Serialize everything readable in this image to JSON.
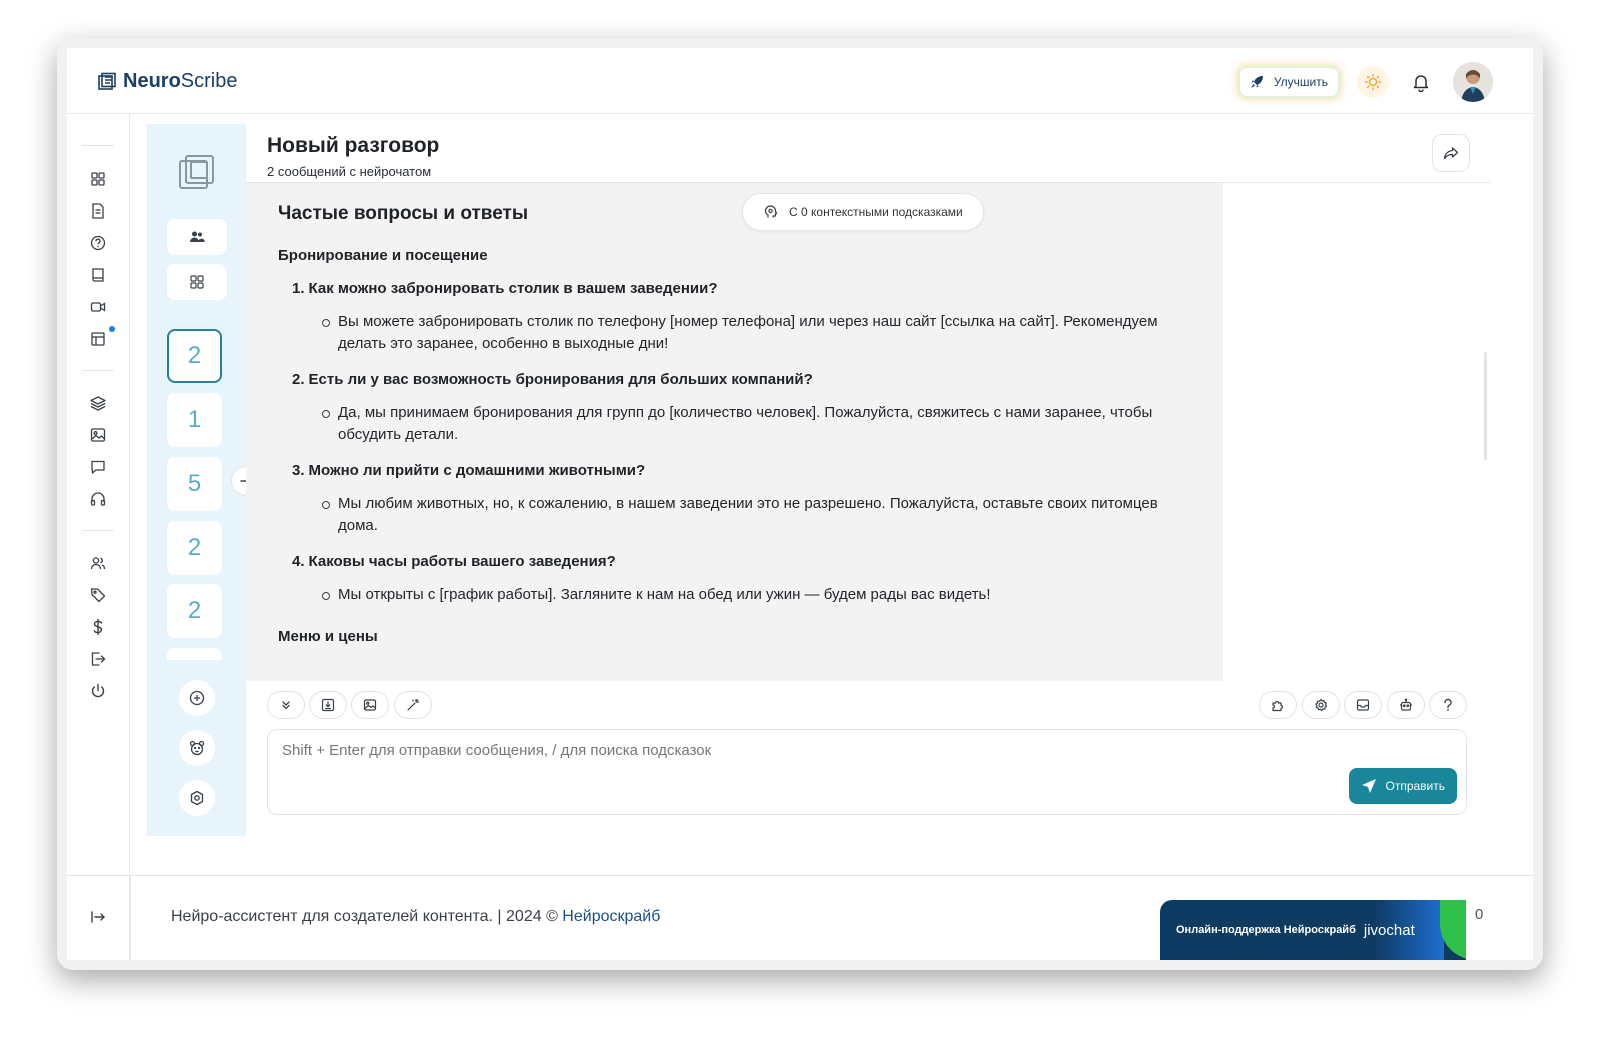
{
  "brand": {
    "name_bold": "Neuro",
    "name_rest": "Scribe"
  },
  "header": {
    "upgrade_label": "Улучшить"
  },
  "colors": {
    "accent": "#1a869a",
    "brand": "#1c3f66",
    "active_border": "#2b7f9c",
    "conv_bg": "#e8f4fb"
  },
  "rail": {
    "icons": [
      "grid-icon",
      "document-icon",
      "help-circle-icon",
      "book-icon",
      "video-icon",
      "table-icon",
      "layers-icon",
      "image-icon",
      "chat-icon",
      "headphones-icon",
      "users-icon",
      "tag-icon",
      "dollar-icon",
      "logout-icon",
      "power-icon"
    ]
  },
  "conversations": {
    "counts": [
      "2",
      "1",
      "5",
      "2",
      "2"
    ]
  },
  "chat": {
    "title": "Новый разговор",
    "subtitle": "2 сообщений с нейрочатом",
    "hint_pill": "С 0 контекстными подсказками",
    "message": {
      "heading": "Частые вопросы и ответы",
      "section1": "Бронирование и посещение",
      "items": [
        {
          "num": "1.",
          "q": "Как можно забронировать столик в вашем заведении?",
          "a": "Вы можете забронировать столик по телефону [номер телефона] или через наш сайт [ссылка на сайт]. Рекомендуем делать это заранее, особенно в выходные дни!"
        },
        {
          "num": "2.",
          "q": "Есть ли у вас возможность бронирования для больших компаний?",
          "a": "Да, мы принимаем бронирования для групп до [количество человек]. Пожалуйста, свяжитесь с нами заранее, чтобы обсудить детали."
        },
        {
          "num": "3.",
          "q": "Можно ли прийти с домашними животными?",
          "a": "Мы любим животных, но, к сожалению, в нашем заведении это не разрешено. Пожалуйста, оставьте своих питомцев дома."
        },
        {
          "num": "4.",
          "q": "Каковы часы работы вашего заведения?",
          "a": "Мы открыты с [график работы]. Загляните к нам на обед или ужин — будем рады вас видеть!"
        }
      ],
      "section2": "Меню и цены"
    },
    "composer": {
      "placeholder": "Shift + Enter для отправки сообщения, / для поиска подсказок",
      "value": "",
      "send_label": "Отправить"
    }
  },
  "footer": {
    "text": "Нейро-ассистент для создателей контента.  | 2024 © ",
    "link": "Нейроскрайб",
    "trailing": "0"
  },
  "support_widget": {
    "label": "Онлайн-поддержка Нейроскрайб",
    "brand": "jivochat"
  }
}
